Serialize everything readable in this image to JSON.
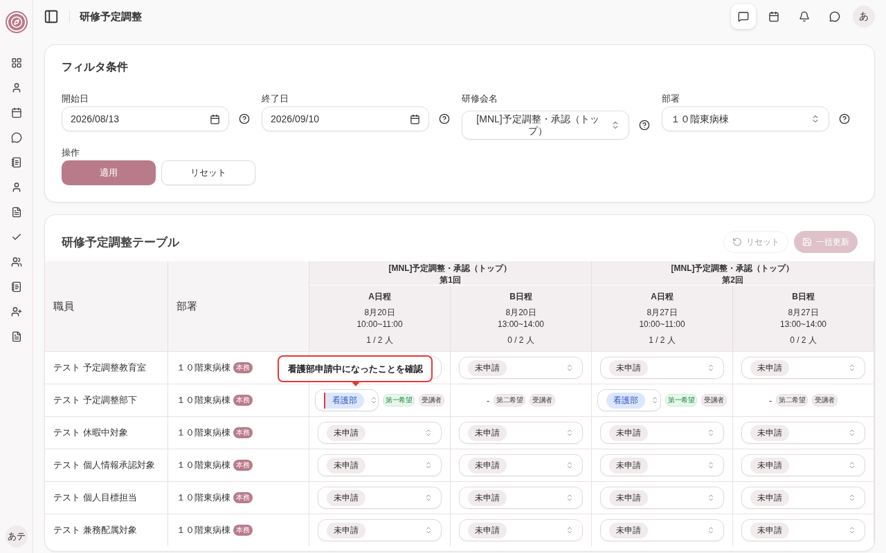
{
  "sidebar": {
    "items": [
      {
        "kind": "dashboard"
      },
      {
        "kind": "user"
      },
      {
        "kind": "calendar"
      },
      {
        "kind": "chat"
      },
      {
        "kind": "notebook"
      },
      {
        "kind": "user"
      },
      {
        "kind": "document"
      },
      {
        "kind": "check"
      },
      {
        "kind": "users"
      },
      {
        "kind": "notebook"
      },
      {
        "kind": "user-plus"
      },
      {
        "kind": "document"
      }
    ],
    "avatar": "あテ"
  },
  "topbar": {
    "title": "研修予定調整",
    "actions": [
      {
        "kind": "feedback",
        "selected": true
      },
      {
        "kind": "calendar",
        "selected": false
      },
      {
        "kind": "bell",
        "selected": false
      },
      {
        "kind": "chat",
        "selected": false
      }
    ],
    "avatar": "あ"
  },
  "filter": {
    "title": "フィルタ条件",
    "fields": [
      {
        "kind": "date",
        "label": "開始日",
        "value": "2026/08/13"
      },
      {
        "kind": "date",
        "label": "終了日",
        "value": "2026/09/10"
      },
      {
        "kind": "select",
        "label": "研修会名",
        "value": "[MNL]予定調整・承認（トップ）"
      },
      {
        "kind": "select",
        "label": "部署",
        "value": "１０階東病棟"
      }
    ],
    "actions_label": "操作",
    "apply_button": "適用",
    "reset_button": "リセット"
  },
  "table": {
    "title": "研修予定調整テーブル",
    "reset_button": {
      "label": "リセット",
      "disabled": true
    },
    "bulk_button": {
      "label": "一括更新",
      "disabled": true
    },
    "columns": [
      "職員",
      "部署"
    ],
    "sessions": [
      {
        "name": "[MNL]予定調整・承認（トップ）",
        "round": "第1回",
        "slots": [
          {
            "label": "A日程",
            "date": "8月20日",
            "time": "10:00~11:00",
            "count": "1 / 2 人"
          },
          {
            "label": "B日程",
            "date": "8月20日",
            "time": "13:00~14:00",
            "count": "0 / 2 人"
          }
        ]
      },
      {
        "name": "[MNL]予定調整・承認（トップ）",
        "round": "第2回",
        "slots": [
          {
            "label": "A日程",
            "date": "8月27日",
            "time": "10:00~11:00",
            "count": "1 / 2 人"
          },
          {
            "label": "B日程",
            "date": "8月27日",
            "time": "13:00~14:00",
            "count": "0 / 2 人"
          }
        ]
      }
    ],
    "tooltip": "看護部申請中になったことを確認",
    "rows": [
      {
        "name": "テスト 予定調整教育室",
        "dept": "１０階東病棟",
        "badge": "本務",
        "cells": [
          {
            "kind": "covered"
          },
          {
            "kind": "select",
            "value": "未申請",
            "color": "#f1ebec"
          },
          {
            "kind": "select",
            "value": "未申請",
            "color": "#f1ebec"
          },
          {
            "kind": "select",
            "value": "未申請",
            "color": "#f1ebec"
          }
        ]
      },
      {
        "name": "テスト 予定調整部下",
        "dept": "１０階東病棟",
        "badge": "本務",
        "cells": [
          {
            "kind": "select",
            "value": "看護部",
            "color": "#dbe7ff",
            "flagged": true,
            "tags": [
              {
                "label": "第一希望",
                "color": "#e9f6ec"
              },
              {
                "label": "受講者",
                "color": "#f1ebec"
              }
            ]
          },
          {
            "kind": "dash",
            "value": "-",
            "tags": [
              {
                "label": "第二希望",
                "color": "#f1ebec"
              },
              {
                "label": "受講者",
                "color": "#f1ebec"
              }
            ]
          },
          {
            "kind": "select",
            "value": "看護部",
            "color": "#dbe7ff",
            "flagged": false,
            "tags": [
              {
                "label": "第一希望",
                "color": "#e9f6ec"
              },
              {
                "label": "受講者",
                "color": "#f1ebec"
              }
            ]
          },
          {
            "kind": "dash",
            "value": "-",
            "tags": [
              {
                "label": "第二希望",
                "color": "#f1ebec"
              },
              {
                "label": "受講者",
                "color": "#f1ebec"
              }
            ]
          }
        ]
      },
      {
        "name": "テスト 休暇中対象",
        "dept": "１０階東病棟",
        "badge": "本務",
        "cells": [
          {
            "kind": "select",
            "value": "未申請",
            "color": "#f1ebec"
          },
          {
            "kind": "select",
            "value": "未申請",
            "color": "#f1ebec"
          },
          {
            "kind": "select",
            "value": "未申請",
            "color": "#f1ebec"
          },
          {
            "kind": "select",
            "value": "未申請",
            "color": "#f1ebec"
          }
        ]
      },
      {
        "name": "テスト 個人情報承認対象",
        "dept": "１０階東病棟",
        "badge": "本務",
        "cells": [
          {
            "kind": "select",
            "value": "未申請",
            "color": "#f1ebec"
          },
          {
            "kind": "select",
            "value": "未申請",
            "color": "#f1ebec"
          },
          {
            "kind": "select",
            "value": "未申請",
            "color": "#f1ebec"
          },
          {
            "kind": "select",
            "value": "未申請",
            "color": "#f1ebec"
          }
        ]
      },
      {
        "name": "テスト 個人目標担当",
        "dept": "１０階東病棟",
        "badge": "本務",
        "cells": [
          {
            "kind": "select",
            "value": "未申請",
            "color": "#f1ebec"
          },
          {
            "kind": "select",
            "value": "未申請",
            "color": "#f1ebec"
          },
          {
            "kind": "select",
            "value": "未申請",
            "color": "#f1ebec"
          },
          {
            "kind": "select",
            "value": "未申請",
            "color": "#f1ebec"
          }
        ]
      },
      {
        "name": "テスト 兼務配属対象",
        "dept": "１０階東病棟",
        "badge": "本務",
        "cells": [
          {
            "kind": "select",
            "value": "未申請",
            "color": "#f1ebec"
          },
          {
            "kind": "select",
            "value": "未申請",
            "color": "#f1ebec"
          },
          {
            "kind": "select",
            "value": "未申請",
            "color": "#f1ebec"
          },
          {
            "kind": "select",
            "value": "未申請",
            "color": "#f1ebec"
          }
        ]
      }
    ]
  }
}
